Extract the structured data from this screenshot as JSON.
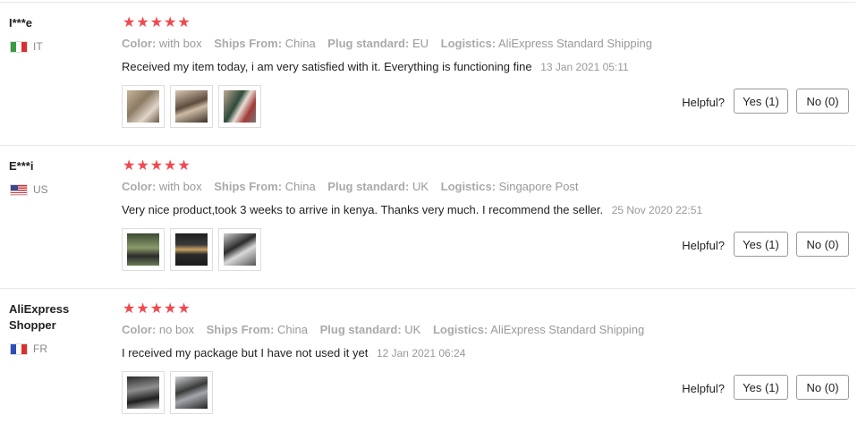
{
  "labels": {
    "helpful": "Helpful?",
    "color": "Color:",
    "ships_from": "Ships From:",
    "plug": "Plug standard:",
    "logistics": "Logistics:"
  },
  "stars": "★★★★★",
  "colors": {
    "star": "#f0494f",
    "muted": "#999999"
  },
  "reviews": [
    {
      "user": "I***e",
      "country": "IT",
      "color": "with box",
      "ships_from": "China",
      "plug": "EU",
      "logistics": "AliExpress Standard Shipping",
      "text": "Received my item today, i am very satisfied with it. Everything is functioning fine",
      "date": "13 Jan 2021 05:11",
      "yes": "Yes (1)",
      "no": "No (0)"
    },
    {
      "user": "E***i",
      "country": "US",
      "color": "with box",
      "ships_from": "China",
      "plug": "UK",
      "logistics": "Singapore Post",
      "text": "Very nice product,took 3 weeks to arrive in kenya. Thanks very much. I recommend the seller.",
      "date": "25 Nov 2020 22:51",
      "yes": "Yes (1)",
      "no": "No (0)"
    },
    {
      "user": "AliExpress Shopper",
      "country": "FR",
      "color": "no box",
      "ships_from": "China",
      "plug": "UK",
      "logistics": "AliExpress Standard Shipping",
      "text": "I received my package but I have not used it yet",
      "date": "12 Jan 2021 06:24",
      "yes": "Yes (1)",
      "no": "No (0)"
    }
  ]
}
